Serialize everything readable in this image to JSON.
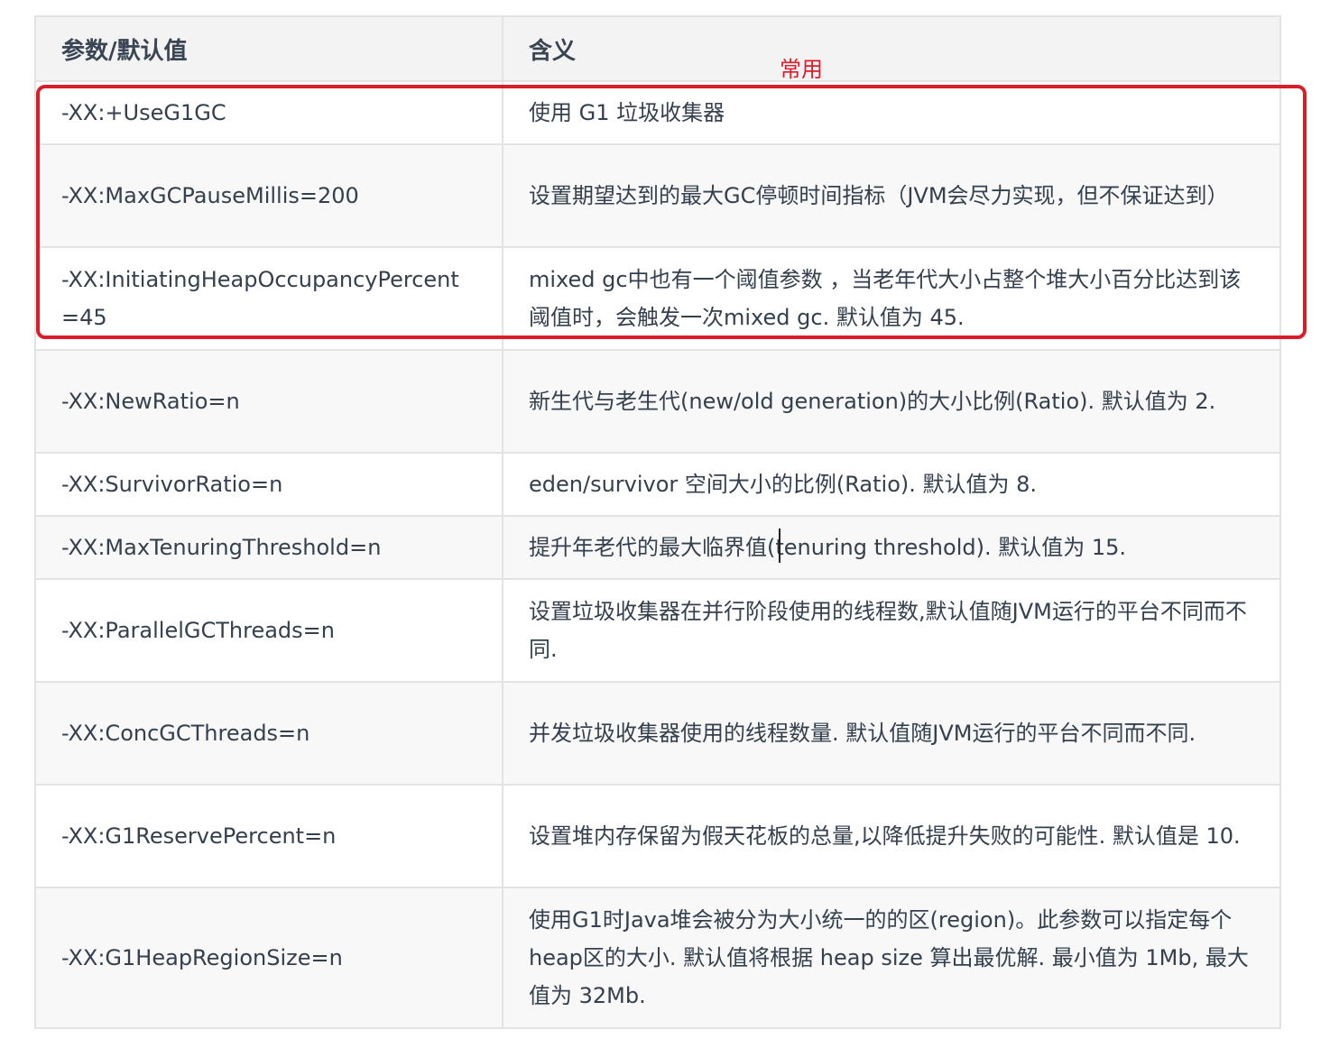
{
  "table": {
    "headers": [
      "参数/默认值",
      "含义"
    ],
    "rows": [
      {
        "param": "-XX:+UseG1GC",
        "meaning": "使用 G1 垃圾收集器"
      },
      {
        "param": "-XX:MaxGCPauseMillis=200",
        "meaning": "设置期望达到的最大GC停顿时间指标（JVM会尽力实现，但不保证达到）"
      },
      {
        "param": "-XX:InitiatingHeapOccupancyPercent=45",
        "meaning": "mixed gc中也有一个阈值参数 ，当老年代大小占整个堆大小百分比达到该阈值时，会触发一次mixed gc. 默认值为 45."
      },
      {
        "param": "-XX:NewRatio=n",
        "meaning": "新生代与老生代(new/old generation)的大小比例(Ratio). 默认值为 2."
      },
      {
        "param": "-XX:SurvivorRatio=n",
        "meaning": "eden/survivor 空间大小的比例(Ratio). 默认值为 8."
      },
      {
        "param": "-XX:MaxTenuringThreshold=n",
        "meaning": "提升年老代的最大临界值(tenuring threshold). 默认值为 15."
      },
      {
        "param": "-XX:ParallelGCThreads=n",
        "meaning": "设置垃圾收集器在并行阶段使用的线程数,默认值随JVM运行的平台不同而不同."
      },
      {
        "param": "-XX:ConcGCThreads=n",
        "meaning": "并发垃圾收集器使用的线程数量. 默认值随JVM运行的平台不同而不同."
      },
      {
        "param": "-XX:G1ReservePercent=n",
        "meaning": "设置堆内存保留为假天花板的总量,以降低提升失败的可能性. 默认值是 10."
      },
      {
        "param": "-XX:G1HeapRegionSize=n",
        "meaning": "使用G1时Java堆会被分为大小统一的的区(region)。此参数可以指定每个heap区的大小. 默认值将根据 heap size 算出最优解. 最小值为 1Mb, 最大值为 32Mb."
      }
    ]
  },
  "annotation": {
    "label": "常用",
    "color": "#d81e2a"
  },
  "colors": {
    "header_bg": "#f3f3f3",
    "border": "#e3e3e3",
    "text": "#34404e"
  }
}
